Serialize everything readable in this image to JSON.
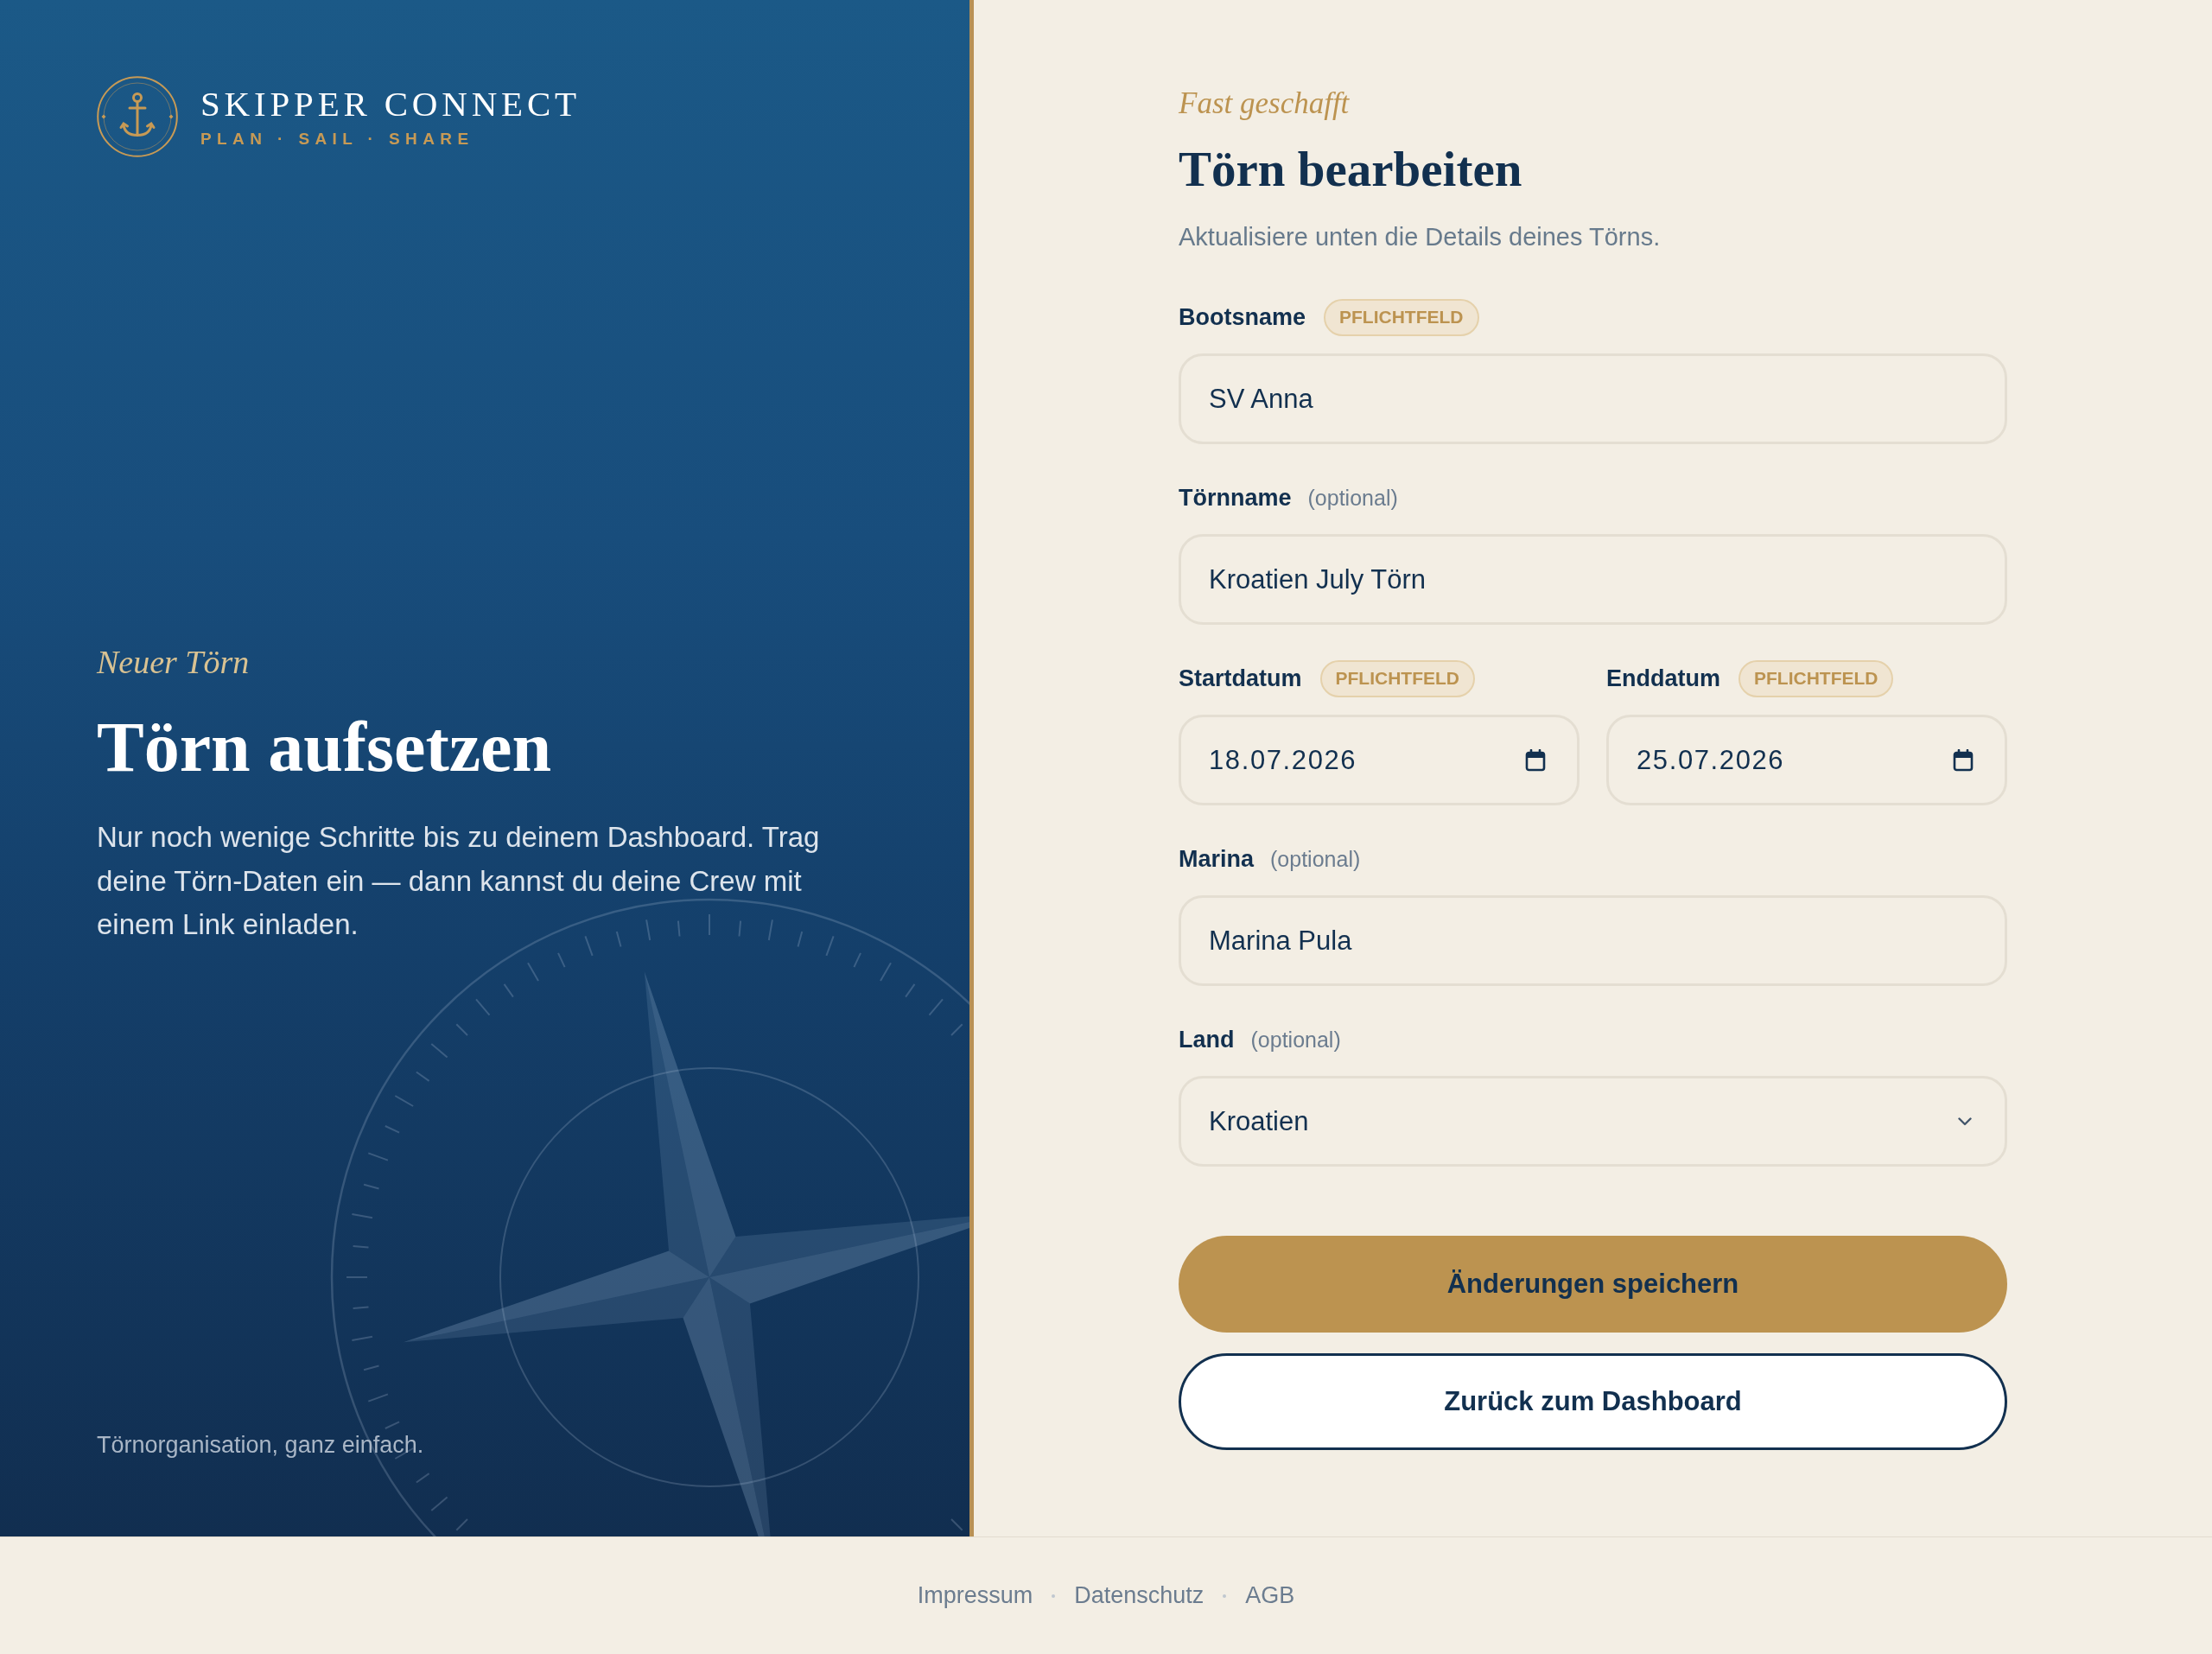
{
  "brand": {
    "name": "SKIPPER CONNECT",
    "tagline": "PLAN · SAIL · SHARE"
  },
  "hero": {
    "eyebrow": "Neuer Törn",
    "title": "Törn aufsetzen",
    "text": "Nur noch wenige Schritte bis zu deinem Dashboard. Trag deine Törn-Daten ein — dann kannst du deine Crew mit einem Link einladen.",
    "footnote": "Törnorganisation, ganz einfach."
  },
  "form": {
    "eyebrow": "Fast geschafft",
    "title": "Törn bearbeiten",
    "subtitle": "Aktualisiere unten die Details deines Törns.",
    "rows": [
      {
        "fields": [
          {
            "label": "Bootsname",
            "tag": {
              "kind": "required",
              "text": "PFLICHTFELD"
            },
            "kind": "text",
            "value": "SV Anna"
          }
        ]
      },
      {
        "fields": [
          {
            "label": "Törnname",
            "tag": {
              "kind": "optional",
              "text": "(optional)"
            },
            "kind": "text",
            "value": "Kroatien July Törn"
          }
        ]
      },
      {
        "fields": [
          {
            "label": "Startdatum",
            "tag": {
              "kind": "required",
              "text": "PFLICHTFELD"
            },
            "kind": "date",
            "value": "18.07.2026"
          },
          {
            "label": "Enddatum",
            "tag": {
              "kind": "required",
              "text": "PFLICHTFELD"
            },
            "kind": "date",
            "value": "25.07.2026"
          }
        ]
      },
      {
        "fields": [
          {
            "label": "Marina",
            "tag": {
              "kind": "optional",
              "text": "(optional)"
            },
            "kind": "text",
            "value": "Marina Pula"
          }
        ]
      },
      {
        "fields": [
          {
            "label": "Land",
            "tag": {
              "kind": "optional",
              "text": "(optional)"
            },
            "kind": "select",
            "value": "Kroatien"
          }
        ]
      }
    ],
    "buttons": [
      {
        "kind": "primary",
        "label": "Änderungen speichern"
      },
      {
        "kind": "secondary",
        "label": "Zurück zum Dashboard"
      }
    ]
  },
  "footer": {
    "links": [
      "Impressum",
      "Datenschutz",
      "AGB"
    ]
  }
}
